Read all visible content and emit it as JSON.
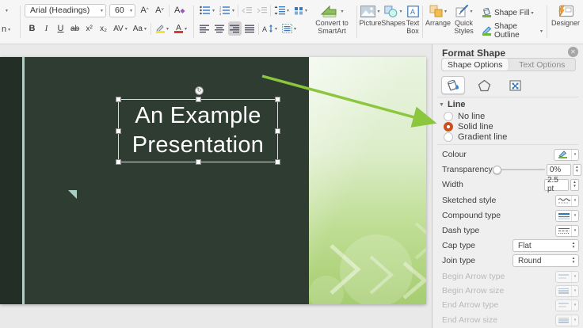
{
  "toolbar": {
    "font_name": "Arial (Headings)",
    "font_size": "60",
    "glyphs": {
      "grow": "A",
      "shrink": "A",
      "clear": "A",
      "bold": "B",
      "italic": "I",
      "underline": "U",
      "strikethrough": "ab",
      "superscript": "x²",
      "subscript": "x₂",
      "char_spacing": "AV",
      "change_case": "Aa",
      "font_color": "A"
    },
    "convert_smartart": "Convert to\nSmartArt",
    "picture": "Picture",
    "shapes": "Shapes",
    "text_box": "Text\nBox",
    "arrange": "Arrange",
    "quick_styles": "Quick\nStyles",
    "shape_fill": "Shape Fill",
    "shape_outline": "Shape Outline",
    "designer": "Designer"
  },
  "slide": {
    "title": "An Example\nPresentation"
  },
  "panel": {
    "title": "Format Shape",
    "tab_shape": "Shape Options",
    "tab_text": "Text Options",
    "section": "Line",
    "radio_no": "No line",
    "radio_solid": "Solid line",
    "radio_gradient": "Gradient line",
    "colour": "Colour",
    "transparency": "Transparency",
    "transparency_value": "0%",
    "width": "Width",
    "width_value": "2.5 pt",
    "sketched": "Sketched style",
    "compound": "Compound type",
    "dash": "Dash type",
    "cap": "Cap type",
    "cap_value": "Flat",
    "join": "Join type",
    "join_value": "Round",
    "begin_arrow_type": "Begin Arrow type",
    "begin_arrow_size": "Begin Arrow size",
    "end_arrow_type": "End Arrow type",
    "end_arrow_size": "End Arrow size"
  },
  "colors": {
    "annotation_arrow": "#8cc63d",
    "radio_selected": "#c9501f",
    "slide_dark": "#2e3c31",
    "slide_dark_strip": "#232f26",
    "slide_accent_line": "#b5cfc7",
    "slide_green_top": "#e9f4e1",
    "slide_green_bottom": "#a6cd70"
  }
}
